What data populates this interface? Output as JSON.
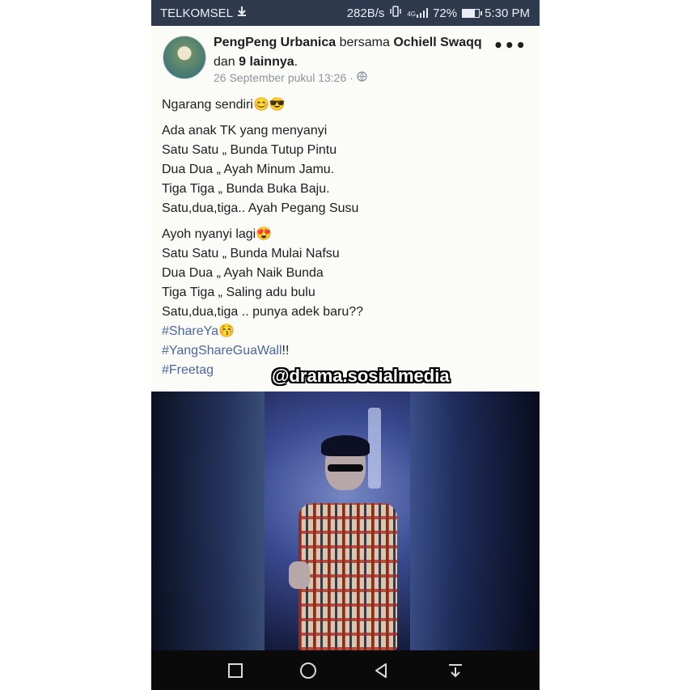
{
  "statusbar": {
    "carrier": "TELKOMSEL",
    "speed": "282B/s",
    "network": "4G",
    "battery": "72%",
    "battery_level": 0.72,
    "time": "5:30 PM"
  },
  "post": {
    "author": "PengPeng Urbanica",
    "with_word": "bersama",
    "tagged": "Ochiell Swaqq",
    "and_word": "dan",
    "others": "9 lainnya",
    "period": ".",
    "timestamp": "26 September pukul 13:26",
    "separator": "·",
    "paragraphs": [
      [
        "Ngarang sendiri😊😎"
      ],
      [
        "Ada anak TK yang menyanyi",
        "Satu Satu „ Bunda Tutup Pintu",
        "Dua Dua „ Ayah Minum Jamu.",
        "Tiga Tiga „ Bunda Buka Baju.",
        "Satu,dua,tiga.. Ayah Pegang Susu"
      ],
      [
        "Ayoh nyanyi lagi😍",
        "Satu Satu „ Bunda Mulai Nafsu",
        "Dua Dua „ Ayah Naik Bunda",
        "Tiga Tiga „ Saling adu bulu",
        "Satu,dua,tiga .. punya adek baru??"
      ]
    ],
    "hashtags": [
      {
        "tag": "#ShareYa",
        "suffix": "😚"
      },
      {
        "tag": "#YangShareGuaWall",
        "suffix": "!!"
      },
      {
        "tag": "#Freetag",
        "suffix": ""
      }
    ]
  },
  "watermark": "@drama.sosialmedia",
  "colors": {
    "statusbar": "#2f3a4f",
    "hashtag": "#4b67a1",
    "meta": "#8d949e"
  }
}
